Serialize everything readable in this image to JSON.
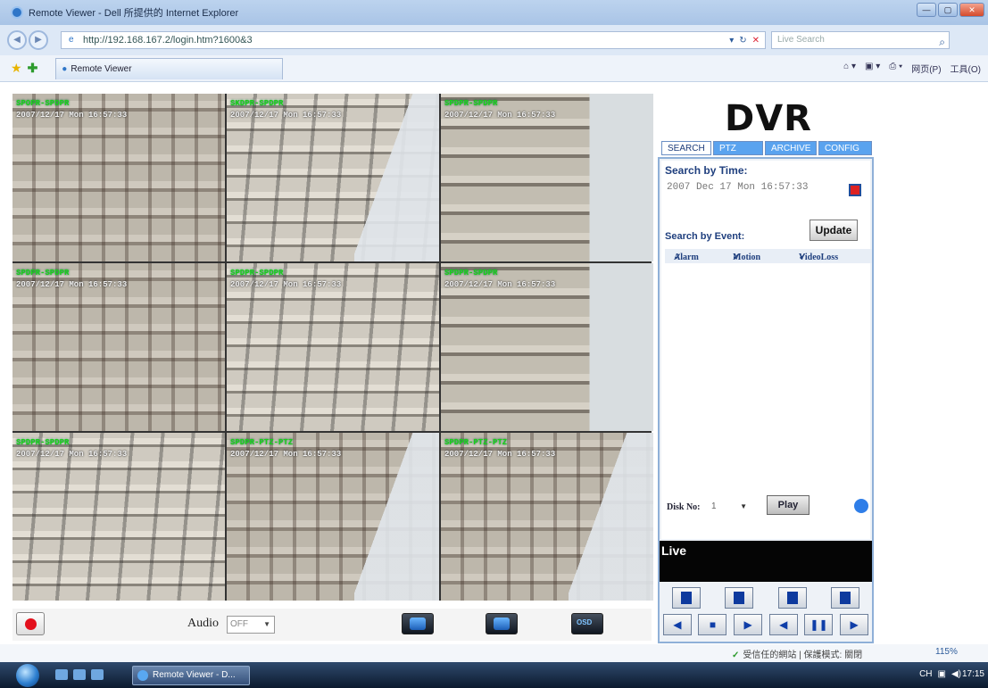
{
  "window": {
    "title": "Remote Viewer - Dell 所提供的 Internet Explorer",
    "controls": [
      "—",
      "▢",
      "✕"
    ]
  },
  "address": {
    "url": "http://192.168.167.2/login.htm?1600&3",
    "search_placeholder": "Live Search"
  },
  "tabs": {
    "favorites_icon": "star-icon",
    "add_favorite_icon": "add-favorite-icon",
    "active_tab": "Remote Viewer",
    "commands": [
      "网页(P)",
      "工具(O)"
    ]
  },
  "cameras": [
    {
      "name": "SPOPR-SPDPR",
      "time": "2007/12/17 Mon 16:57:33"
    },
    {
      "name": "SKDPR-SPDPR",
      "time": "2007/12/17 Mon 16:57:33"
    },
    {
      "name": "SPDPR-SPDPR",
      "time": "2007/12/17 Mon 16:57:33"
    },
    {
      "name": "SPDPR-SPDPR",
      "time": "2007/12/17 Mon 16:57:33"
    },
    {
      "name": "SPDPR-SPDPR",
      "time": "2007/12/17 Mon 16:57:33"
    },
    {
      "name": "SPDPR-SPDPR",
      "time": "2007/12/17 Mon 16:57:33"
    },
    {
      "name": "SPDPR-SPDPR",
      "time": "2007/12/17 Mon 16:57:33"
    },
    {
      "name": "SPDPR-PTZ-PTZ",
      "time": "2007/12/17 Mon 16:57:33"
    },
    {
      "name": "SPDPR-PTZ-PTZ",
      "time": "2007/12/17 Mon 16:57:33"
    }
  ],
  "bottom": {
    "audio_label": "Audio",
    "audio_value": "OFF",
    "osd_label": "OSD"
  },
  "dvr": {
    "title": "DVR",
    "tabs": [
      "SEARCH",
      "PTZ",
      "ARCHIVE",
      "CONFIG"
    ],
    "search_by_time_label": "Search by Time:",
    "search_time_value": "2007 Dec 17 Mon 16:57:33",
    "search_by_event_label": "Search by Event:",
    "update_label": "Update",
    "events": [
      "Alarm",
      "Motion",
      "VideoLoss"
    ],
    "disk_label": "Disk No:",
    "disk_value": "1",
    "play_label": "Play",
    "live_label": "Live"
  },
  "status": {
    "zone_text": "受信任的網站 | 保護模式: 關閉",
    "zoom": "115%"
  },
  "taskbar": {
    "task_label": "Remote Viewer - D...",
    "tray_text": "CH",
    "clock": "17:15"
  },
  "colors": {
    "accent": "#2f7ee8",
    "record_red": "#e3101c",
    "osd_green": "#19d119",
    "panel_border": "#8fb0d8"
  }
}
